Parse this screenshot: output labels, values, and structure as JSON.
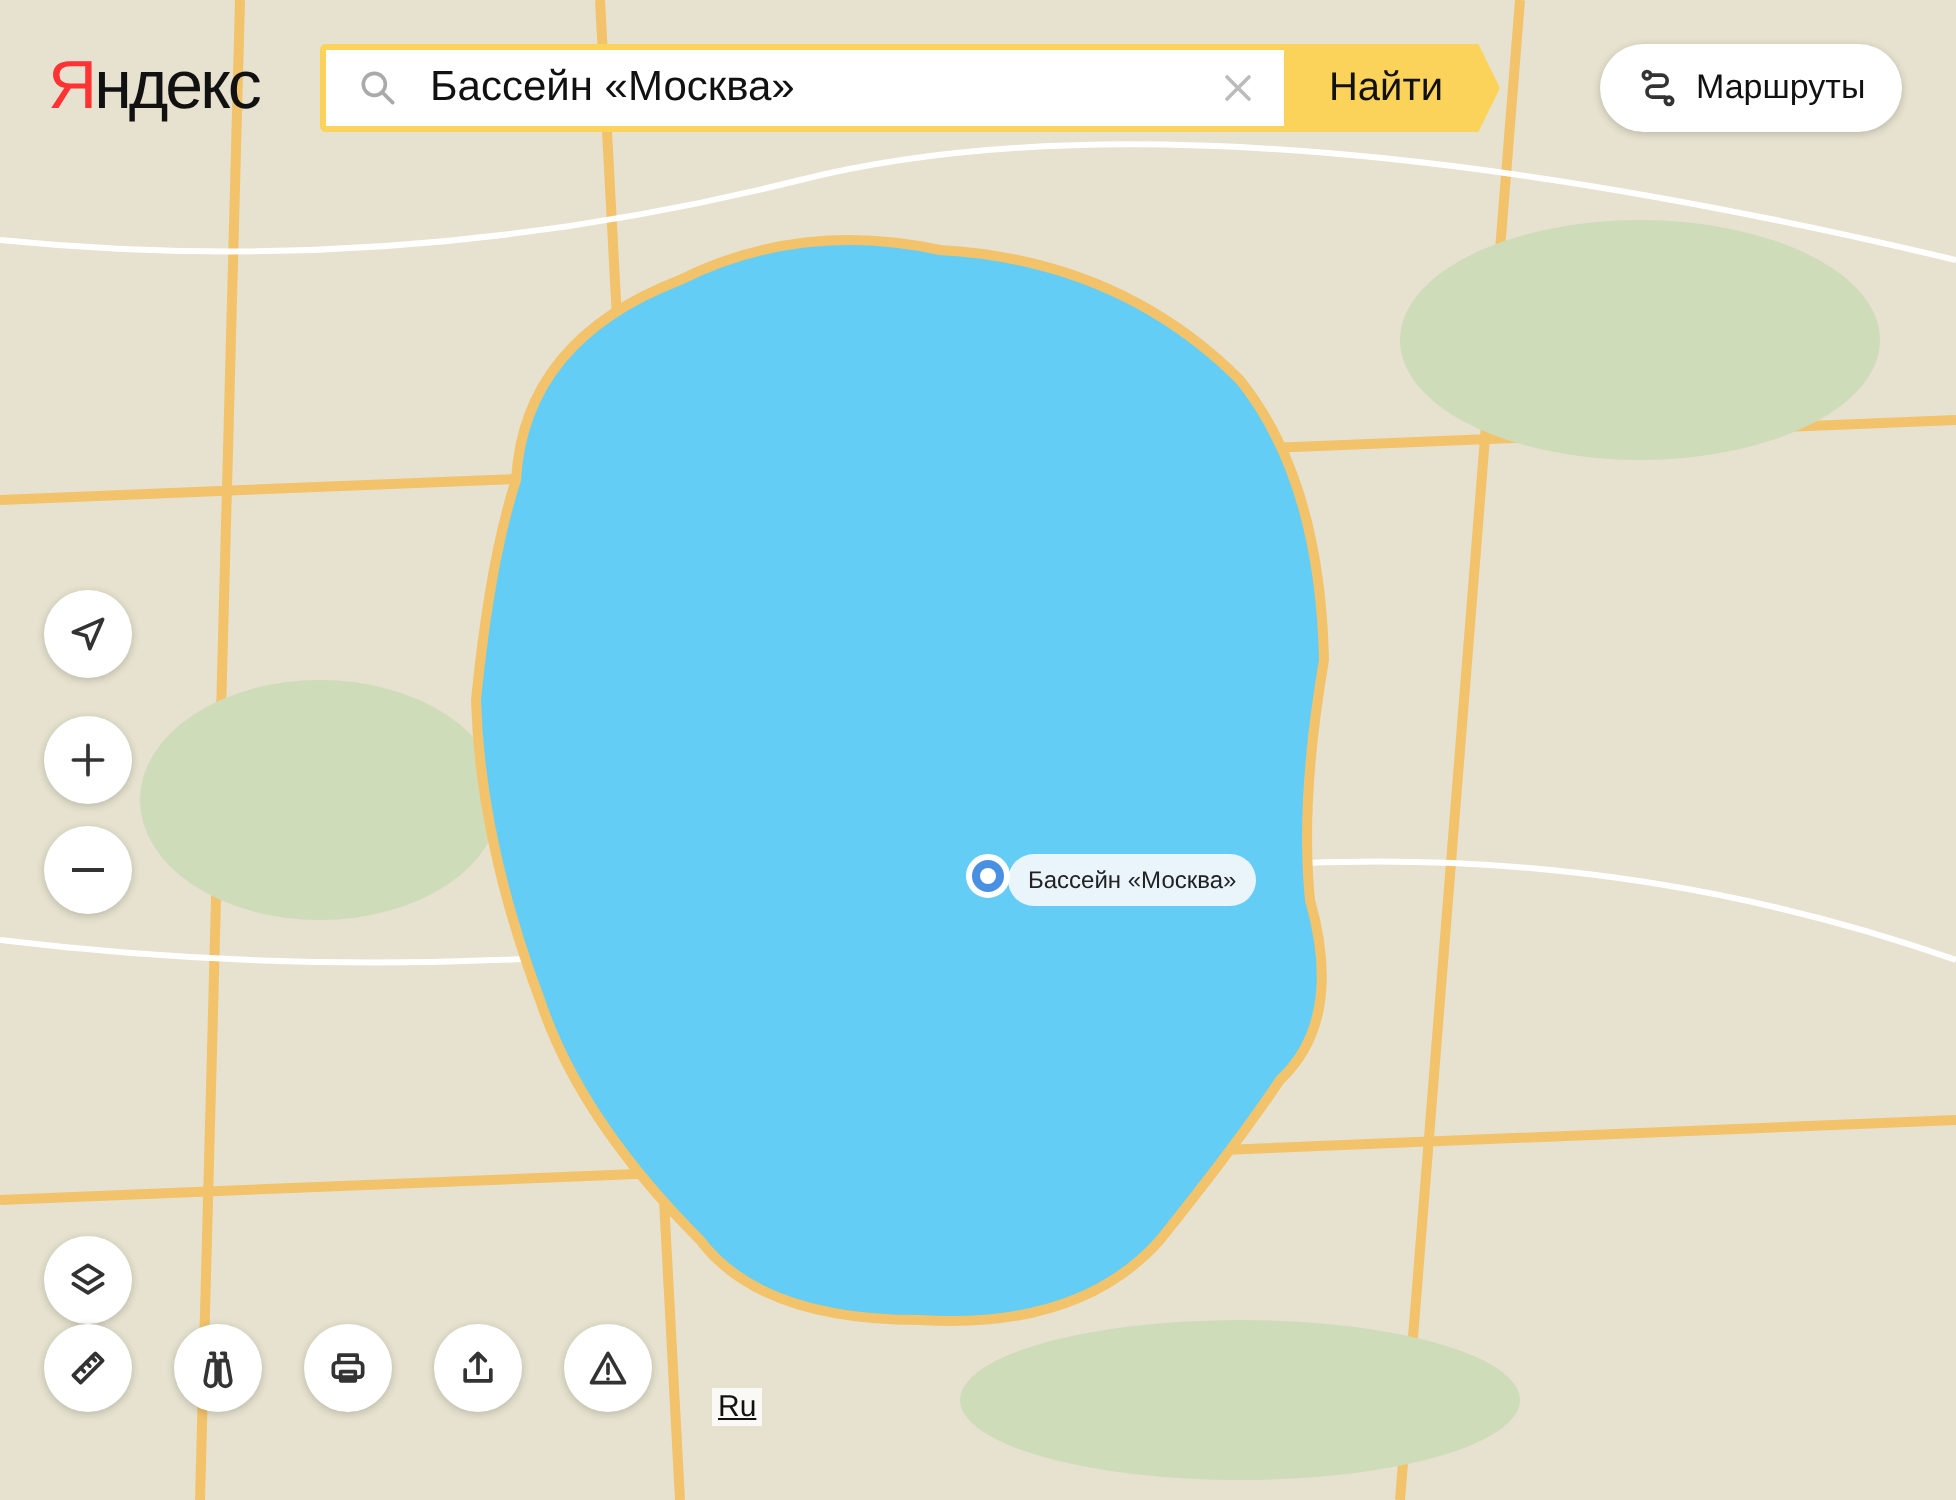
{
  "logo": "Яндекс",
  "search": {
    "value": "Бассейн «Москва»",
    "button": "Найти"
  },
  "routes_button": "Маршруты",
  "marker": {
    "label": "Бассейн «Москва»"
  },
  "language_link": "Ru"
}
